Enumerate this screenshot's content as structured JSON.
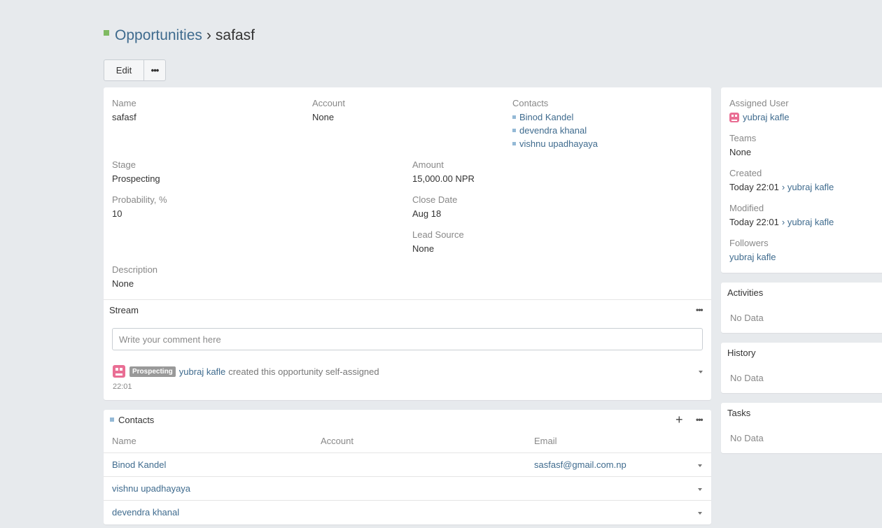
{
  "header": {
    "module": "Opportunities",
    "separator": "›",
    "title": "safasf"
  },
  "actions": {
    "edit": "Edit",
    "more": "•••"
  },
  "detail": {
    "name": {
      "label": "Name",
      "value": "safasf"
    },
    "account": {
      "label": "Account",
      "value": "None"
    },
    "contacts": {
      "label": "Contacts",
      "items": [
        "Binod Kandel",
        "devendra khanal",
        "vishnu upadhayaya"
      ]
    },
    "stage": {
      "label": "Stage",
      "value": "Prospecting"
    },
    "amount": {
      "label": "Amount",
      "value": "15,000.00 NPR"
    },
    "probability": {
      "label": "Probability, %",
      "value": "10"
    },
    "close_date": {
      "label": "Close Date",
      "value": "Aug 18"
    },
    "lead_source": {
      "label": "Lead Source",
      "value": "None"
    },
    "description": {
      "label": "Description",
      "value": "None"
    }
  },
  "stream": {
    "title": "Stream",
    "menu": "•••",
    "placeholder": "Write your comment here",
    "note": {
      "badge": "Prospecting",
      "user": "yubraj kafle",
      "text": "created this opportunity self-assigned",
      "time": "22:01"
    }
  },
  "contacts_panel": {
    "title": "Contacts",
    "add": "+",
    "menu": "•••",
    "columns": [
      "Name",
      "Account",
      "Email"
    ],
    "rows": [
      {
        "name": "Binod Kandel",
        "account": "",
        "email": "sasfasf@gmail.com.np"
      },
      {
        "name": "vishnu upadhayaya",
        "account": "",
        "email": ""
      },
      {
        "name": "devendra khanal",
        "account": "",
        "email": ""
      }
    ]
  },
  "sidebar": {
    "assigned_user": {
      "label": "Assigned User",
      "value": "yubraj kafle"
    },
    "teams": {
      "label": "Teams",
      "value": "None"
    },
    "created": {
      "label": "Created",
      "time": "Today 22:01",
      "arrow": "›",
      "user": "yubraj kafle"
    },
    "modified": {
      "label": "Modified",
      "time": "Today 22:01",
      "arrow": "›",
      "user": "yubraj kafle"
    },
    "followers": {
      "label": "Followers",
      "value": "yubraj kafle"
    },
    "activities": {
      "title": "Activities",
      "empty": "No Data"
    },
    "history": {
      "title": "History",
      "empty": "No Data"
    },
    "tasks": {
      "title": "Tasks",
      "empty": "No Data"
    }
  },
  "colors": {
    "link": "#3f6b8e",
    "background": "#e7eaed",
    "avatar": "#e96e94",
    "badge": "#999999"
  }
}
